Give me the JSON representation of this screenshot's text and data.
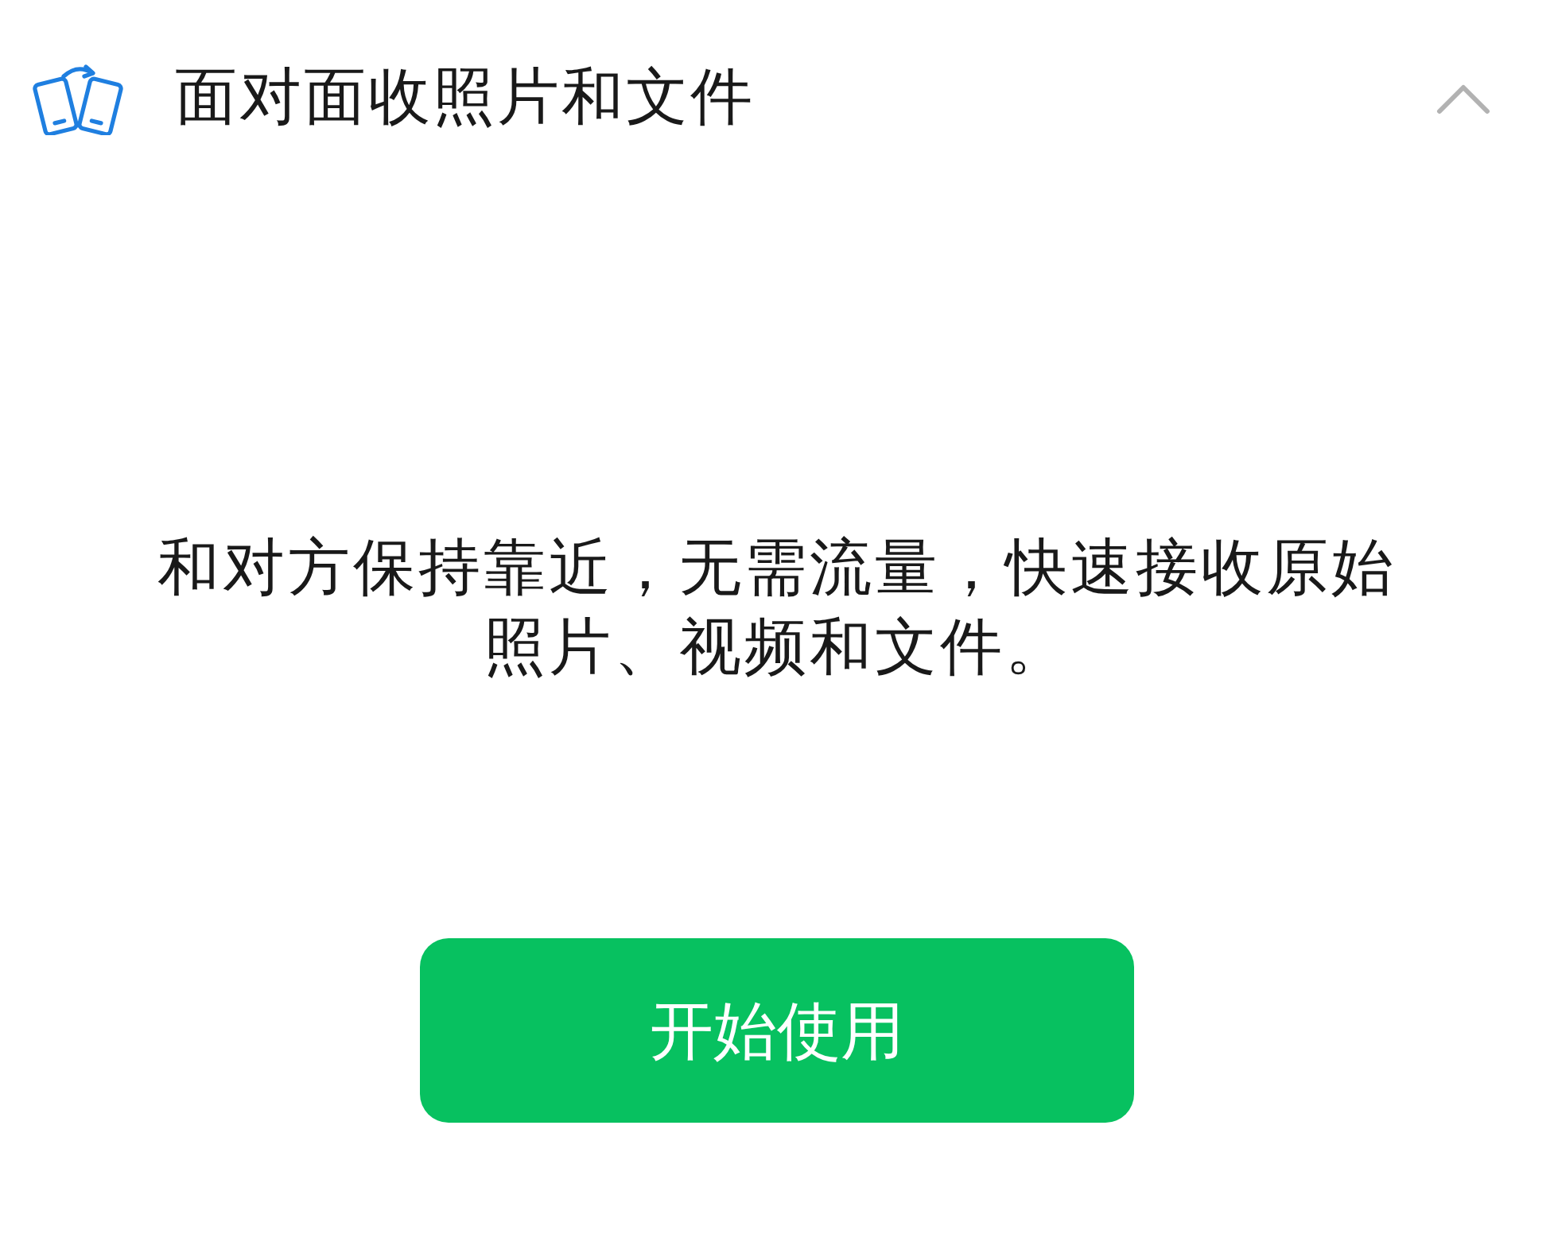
{
  "header": {
    "title": "面对面收照片和文件",
    "expanded": true
  },
  "description": "和对方保持靠近，无需流量，快速接收原始照片、视频和文件。",
  "start_button": {
    "label": "开始使用"
  }
}
